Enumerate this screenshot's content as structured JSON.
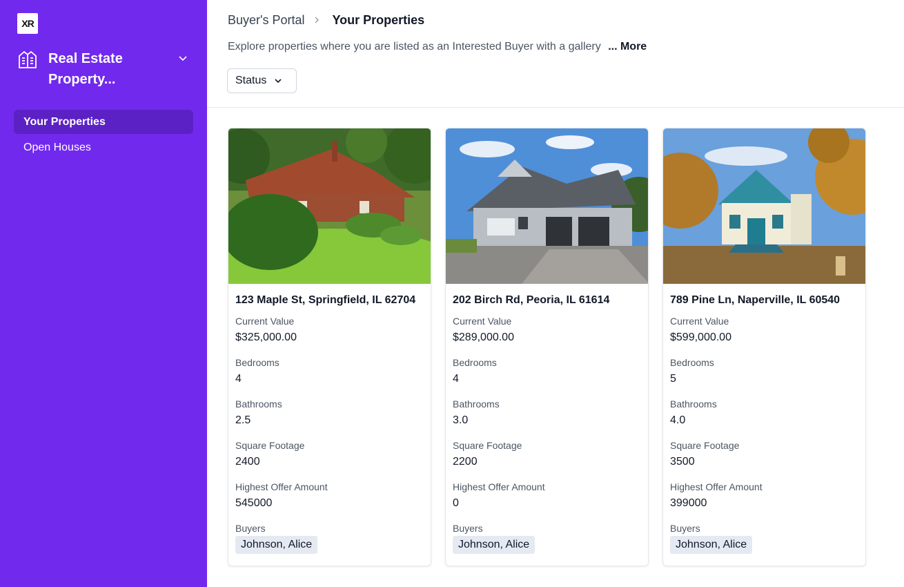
{
  "sidebar": {
    "logo_text": "XR",
    "app_name": "Real Estate Property...",
    "nav": [
      {
        "label": "Your Properties",
        "active": true
      },
      {
        "label": "Open Houses",
        "active": false
      }
    ]
  },
  "header": {
    "breadcrumb_root": "Buyer's Portal",
    "breadcrumb_current": "Your Properties",
    "description": "Explore properties where you are listed as an Interested Buyer with a gallery",
    "more_label": "... More",
    "status_filter": "Status"
  },
  "labels": {
    "current_value": "Current Value",
    "bedrooms": "Bedrooms",
    "bathrooms": "Bathrooms",
    "square_footage": "Square Footage",
    "highest_offer": "Highest Offer Amount",
    "buyers": "Buyers"
  },
  "properties": [
    {
      "address": "123 Maple St, Springfield, IL 62704",
      "current_value": "$325,000.00",
      "bedrooms": "4",
      "bathrooms": "2.5",
      "square_footage": "2400",
      "highest_offer": "545000",
      "buyer": "Johnson, Alice"
    },
    {
      "address": "202 Birch Rd, Peoria, IL 61614",
      "current_value": "$289,000.00",
      "bedrooms": "4",
      "bathrooms": "3.0",
      "square_footage": "2200",
      "highest_offer": "0",
      "buyer": "Johnson, Alice"
    },
    {
      "address": "789 Pine Ln, Naperville, IL 60540",
      "current_value": "$599,000.00",
      "bedrooms": "5",
      "bathrooms": "4.0",
      "square_footage": "3500",
      "highest_offer": "399000",
      "buyer": "Johnson, Alice"
    }
  ],
  "colors": {
    "sidebar": "#7229ee",
    "nav_active": "#5c21c4",
    "chip": "#e5e9f2"
  }
}
